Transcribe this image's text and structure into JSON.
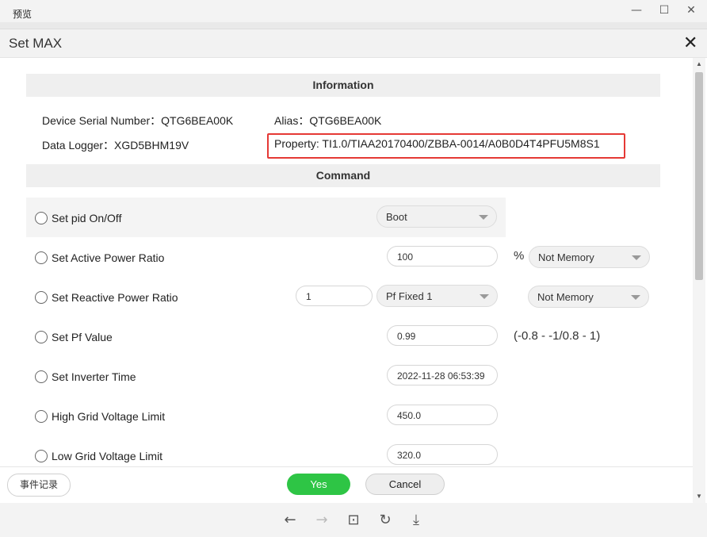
{
  "viewer": {
    "title": "预览",
    "minimize": "—",
    "maximize": "☐",
    "close": "✕"
  },
  "dialog": {
    "title": "Set MAX",
    "close": "✕"
  },
  "info": {
    "section_title": "Information",
    "serial_label": "Device Serial Number：QTG6BEA00K",
    "alias_label": "Alias：QTG6BEA00K",
    "logger_label": "Data Logger：XGD5BHM19V",
    "property_label": "Property: TI1.0/TIAA20170400/ZBBA-0014/A0B0D4T4PFU5M8S1"
  },
  "command": {
    "section_title": "Command",
    "rows": [
      {
        "label": "Set pid On/Off",
        "select": "Boot"
      },
      {
        "label": "Set Active Power Ratio",
        "value": "100",
        "unit": "%",
        "memory": "Not Memory"
      },
      {
        "label": "Set Reactive Power Ratio",
        "value": "1",
        "mode": "Pf Fixed 1",
        "memory": "Not Memory"
      },
      {
        "label": "Set Pf Value",
        "value": "0.99",
        "range": "(-0.8 - -1/0.8 - 1)"
      },
      {
        "label": "Set Inverter Time",
        "value": "2022-11-28 06:53:39"
      },
      {
        "label": "High Grid Voltage Limit",
        "value": "450.0"
      },
      {
        "label": "Low Grid Voltage Limit",
        "value": "320.0"
      }
    ]
  },
  "footer": {
    "log_button": "事件记录",
    "yes_button": "Yes",
    "cancel_button": "Cancel"
  },
  "toolbar": {
    "back_icon": "←",
    "forward_icon": "→",
    "fit_icon": "⊡",
    "rotate_icon": "↻",
    "download_icon": "⤓"
  },
  "colors": {
    "accent_green": "#2ec545",
    "highlight_red": "#e53935"
  }
}
